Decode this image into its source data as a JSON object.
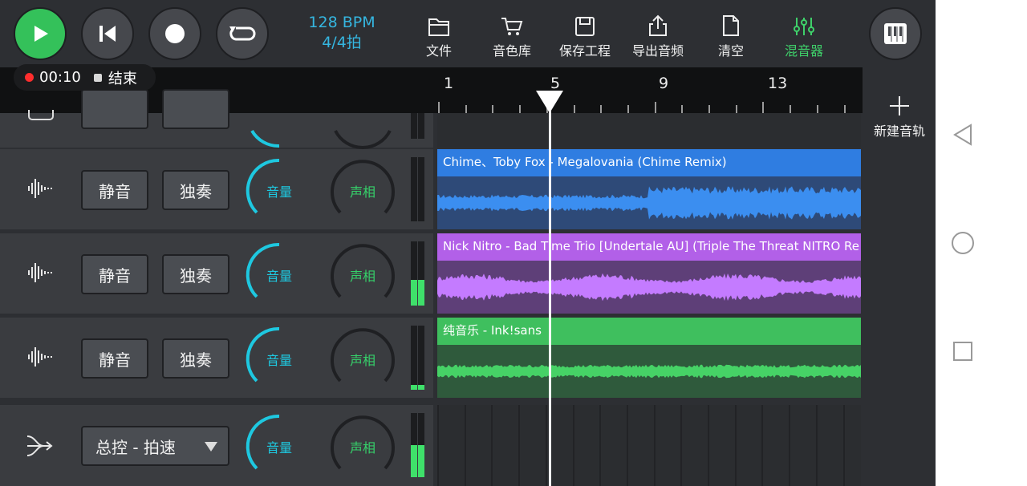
{
  "transport": {
    "play": "play-icon",
    "rewind": "skip-back-icon",
    "record": "record-icon",
    "loop": "loop-icon"
  },
  "tempo": {
    "bpm": "128 BPM",
    "signature": "4/4拍"
  },
  "toolbar": [
    {
      "icon": "folder-icon",
      "label": "文件"
    },
    {
      "icon": "cart-icon",
      "label": "音色库"
    },
    {
      "icon": "save-icon",
      "label": "保存工程"
    },
    {
      "icon": "export-icon",
      "label": "导出音频"
    },
    {
      "icon": "clear-icon",
      "label": "清空"
    },
    {
      "icon": "mixer-icon",
      "label": "混音器"
    }
  ],
  "recording": {
    "time": "00:10",
    "stop_label": "结束"
  },
  "ruler": {
    "bars": [
      "1",
      "5",
      "9",
      "13"
    ]
  },
  "new_track_label": "新建音轨",
  "tracks": [
    {
      "mute": "静音",
      "solo": "独奏",
      "volume": "音量",
      "pan": "声相",
      "clip_title": "Chime、Toby Fox - Megalovania (Chime Remix)",
      "color": "#2f7de1",
      "wave_bg": "#2e4a78",
      "wave_color": "#3b8ef0",
      "meter_level": 0
    },
    {
      "mute": "静音",
      "solo": "独奏",
      "volume": "音量",
      "pan": "声相",
      "clip_title": "Nick Nitro - Bad Time Trio [Undertale AU] (Triple The Threat NITRO Re",
      "color": "#b260e8",
      "wave_bg": "#5e3f78",
      "wave_color": "#c47bff",
      "meter_level": 0.4
    },
    {
      "mute": "静音",
      "solo": "独奏",
      "volume": "音量",
      "pan": "声相",
      "clip_title": "纯音乐 - Ink!sans",
      "color": "#3fbf5e",
      "wave_bg": "#2f5a3c",
      "wave_color": "#46d266",
      "meter_level": 0.08
    }
  ],
  "master": {
    "selector": "总控 - 拍速",
    "volume": "音量",
    "pan": "声相",
    "meter_level": 0.5
  },
  "colors": {
    "accent_cyan": "#1ec8e0",
    "green": "#34c15a"
  }
}
